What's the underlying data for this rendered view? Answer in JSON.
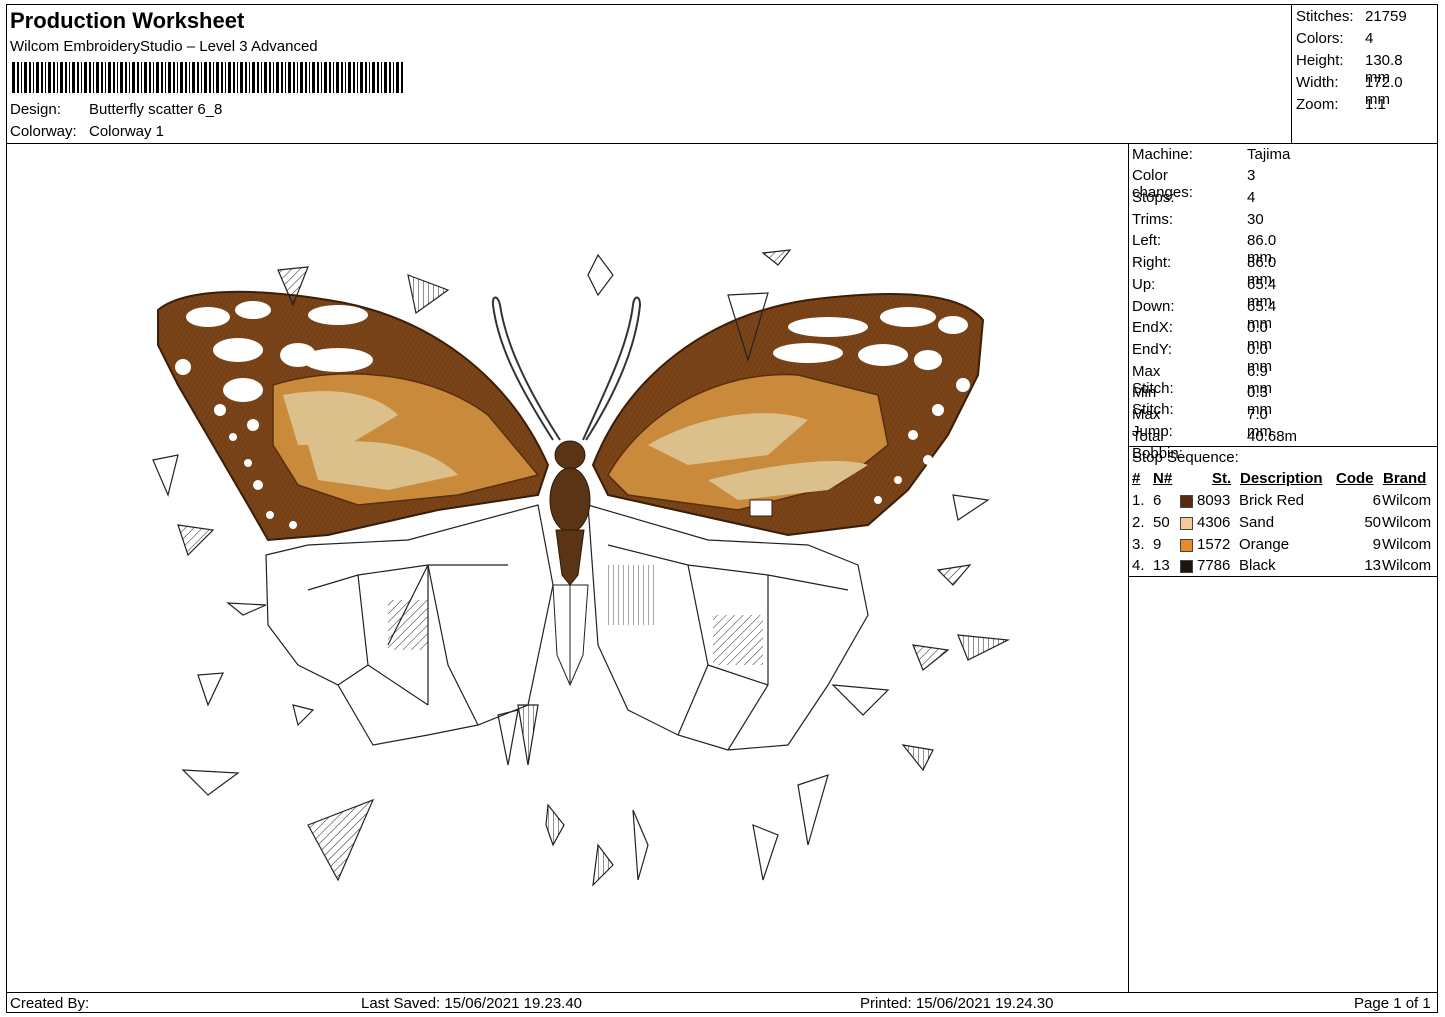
{
  "header": {
    "title": "Production Worksheet",
    "software": "Wilcom EmbroideryStudio – Level 3 Advanced",
    "design_label": "Design:",
    "design_value": "Butterfly scatter 6_8",
    "colorway_label": "Colorway:",
    "colorway_value": "Colorway 1"
  },
  "summary": [
    {
      "label": "Stitches:",
      "value": "21759"
    },
    {
      "label": "Colors:",
      "value": "4"
    },
    {
      "label": "Height:",
      "value": "130.8 mm"
    },
    {
      "label": "Width:",
      "value": "172.0 mm"
    },
    {
      "label": "Zoom:",
      "value": "1:1"
    }
  ],
  "machine": [
    {
      "label": "Machine:",
      "value": "Tajima"
    },
    {
      "label": "Color changes:",
      "value": "3"
    },
    {
      "label": "Stops:",
      "value": "4"
    },
    {
      "label": "Trims:",
      "value": "30"
    },
    {
      "label": "Left:",
      "value": "86.0 mm"
    },
    {
      "label": "Right:",
      "value": "86.0 mm"
    },
    {
      "label": "Up:",
      "value": "65.4 mm"
    },
    {
      "label": "Down:",
      "value": "65.4 mm"
    },
    {
      "label": "EndX:",
      "value": "0.0 mm"
    },
    {
      "label": "EndY:",
      "value": "0.0 mm"
    },
    {
      "label": "Max Stitch:",
      "value": "6.9 mm"
    },
    {
      "label": "Min Stitch:",
      "value": "0.3 mm"
    },
    {
      "label": "Max Jump:",
      "value": "7.0 mm"
    },
    {
      "label": "Total Bobbin:",
      "value": "40.68m"
    }
  ],
  "stop_sequence": {
    "title": "Stop Sequence:",
    "columns": [
      "#",
      "N#",
      "St.",
      "Description",
      "Code",
      "Brand"
    ],
    "rows": [
      {
        "idx": "1.",
        "n": "6",
        "color": "#5a2a0e",
        "st": "8093",
        "description": "Brick Red",
        "code": "6",
        "brand": "Wilcom"
      },
      {
        "idx": "2.",
        "n": "50",
        "color": "#f6c99a",
        "st": "4306",
        "description": "Sand",
        "code": "50",
        "brand": "Wilcom"
      },
      {
        "idx": "3.",
        "n": "9",
        "color": "#e8892a",
        "st": "1572",
        "description": "Orange",
        "code": "9",
        "brand": "Wilcom"
      },
      {
        "idx": "4.",
        "n": "13",
        "color": "#1e1410",
        "st": "7786",
        "description": "Black",
        "code": "13",
        "brand": "Wilcom"
      }
    ]
  },
  "footer": {
    "created_by": "Created By:",
    "last_saved": "Last Saved: 15/06/2021 19.23.40",
    "printed": "Printed: 15/06/2021 19.24.30",
    "page": "Page 1 of 1"
  },
  "design_colors": {
    "wing_dark": "#7a4418",
    "wing_mid": "#c98a3c",
    "wing_light": "#dcc08c",
    "body": "#5a3414"
  }
}
